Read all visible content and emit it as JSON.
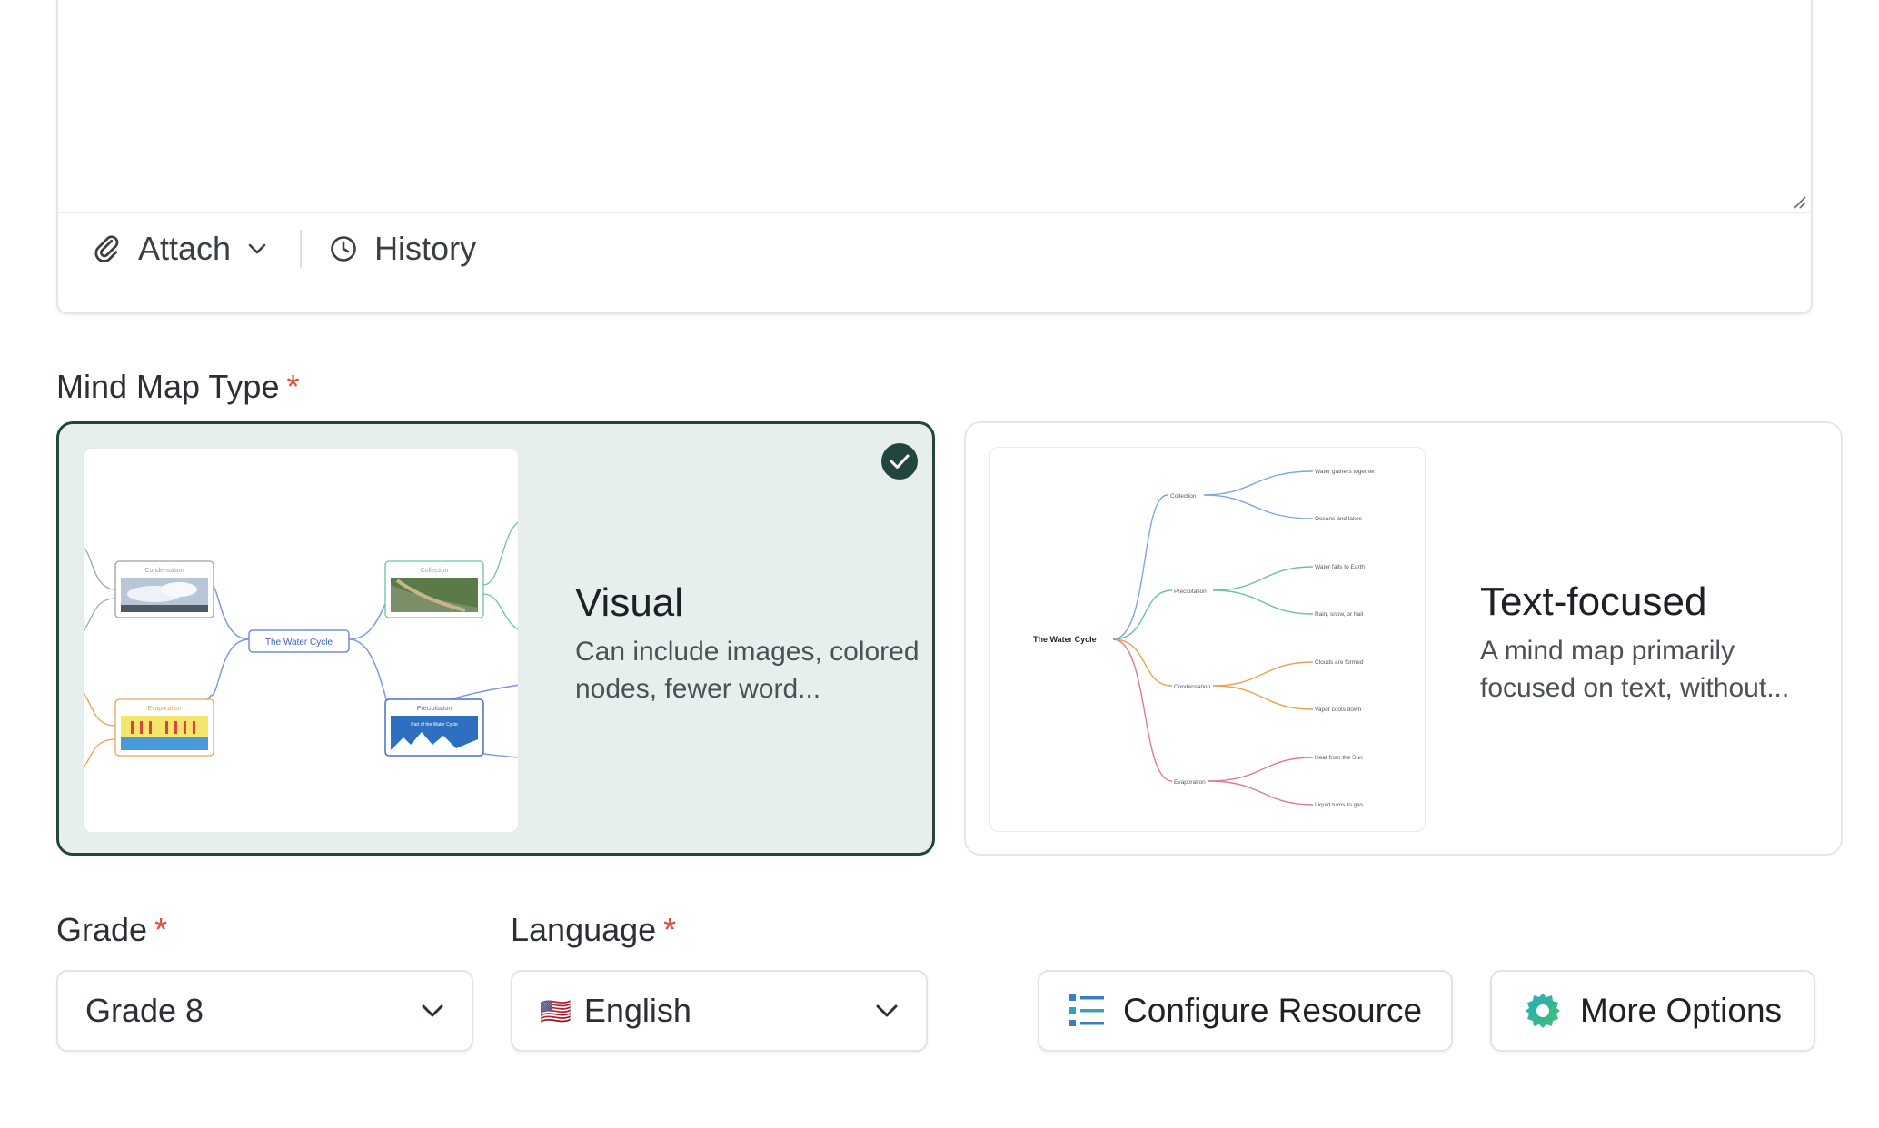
{
  "editor": {
    "attach_label": "Attach",
    "history_label": "History"
  },
  "mind_map_type": {
    "label": "Mind Map Type",
    "required_mark": "*",
    "options": [
      {
        "title": "Visual",
        "description": "Can include images, colored nodes, fewer word...",
        "selected": true,
        "preview": {
          "center": "The Water Cycle",
          "nodes": [
            "Condensation",
            "Collection",
            "Evaporation",
            "Precipitation"
          ],
          "precip_caption": "Part of the Water Cycle"
        }
      },
      {
        "title": "Text-focused",
        "description": "A mind map primarily focused on text, without...",
        "selected": false,
        "preview": {
          "center": "The Water Cycle",
          "branches": [
            "Collection",
            "Precipitation",
            "Condensation",
            "Evaporation"
          ],
          "leaves": [
            "Water gathers together",
            "Oceans and lakes",
            "Water falls to Earth",
            "Rain, snow, or hail",
            "Clouds are formed",
            "Vapor cools down",
            "Heat from the Sun",
            "Liquid turns to gas"
          ]
        }
      }
    ]
  },
  "grade": {
    "label": "Grade",
    "required_mark": "*",
    "value": "Grade 8"
  },
  "language": {
    "label": "Language",
    "required_mark": "*",
    "value": "English",
    "flag": "🇺🇸"
  },
  "actions": {
    "configure_label": "Configure Resource",
    "more_options_label": "More Options"
  },
  "colors": {
    "selected_border": "#22463e",
    "selected_bg": "#e6efec",
    "required": "#e04a3f",
    "branch_blue": "#7aa9e6",
    "branch_green": "#6cc4a0",
    "branch_orange": "#f0a050",
    "branch_pink": "#e07a92"
  }
}
